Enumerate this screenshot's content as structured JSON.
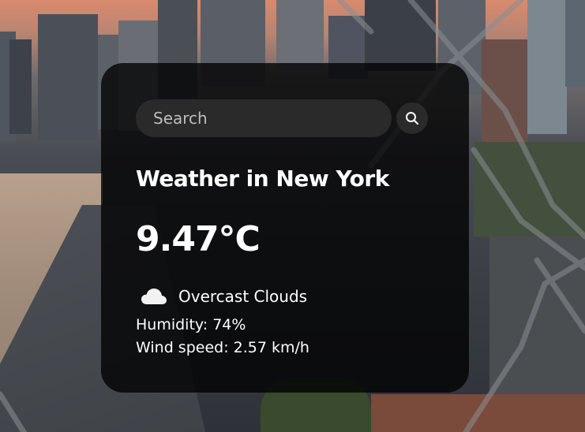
{
  "search": {
    "placeholder": "Search",
    "button_icon": "magnifier-icon"
  },
  "weather": {
    "title": "Weather in New York",
    "temperature": "9.47°C",
    "condition_icon": "cloud-icon",
    "description": "Overcast Clouds",
    "humidity": "Humidity: 74%",
    "wind": "Wind speed: 2.57 km/h"
  },
  "colors": {
    "card_background": "#000000c7",
    "text": "#ffffff",
    "input_background": "#2a2a2a"
  }
}
